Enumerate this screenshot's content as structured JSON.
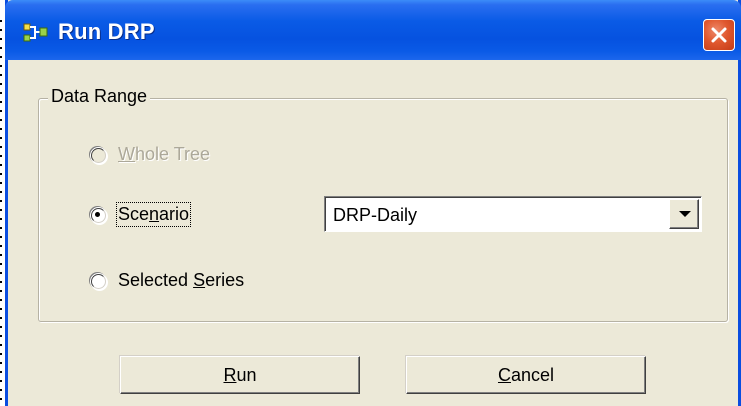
{
  "window": {
    "title": "Run DRP",
    "icon": "drp-run-icon",
    "close_icon": "close-icon"
  },
  "data_range": {
    "label": "Data Range",
    "options": [
      {
        "id": "whole-tree",
        "prefix": "",
        "mnemonic": "W",
        "suffix": "hole Tree",
        "enabled": false,
        "selected": false
      },
      {
        "id": "scenario",
        "prefix": "Sce",
        "mnemonic": "n",
        "suffix": "ario",
        "enabled": true,
        "selected": true
      },
      {
        "id": "selected-series",
        "prefix": "Selected ",
        "mnemonic": "S",
        "suffix": "eries",
        "enabled": true,
        "selected": false
      }
    ],
    "scenario_select": {
      "value": "DRP-Daily"
    }
  },
  "buttons": {
    "run": {
      "prefix": "",
      "mnemonic": "R",
      "suffix": "un"
    },
    "cancel": {
      "prefix": "",
      "mnemonic": "C",
      "suffix": "ancel"
    }
  },
  "colors": {
    "titlebar": "#0a5be6",
    "dialog_bg": "#ece9d8",
    "close_button": "#e0582f",
    "disabled_text": "#aca899"
  }
}
